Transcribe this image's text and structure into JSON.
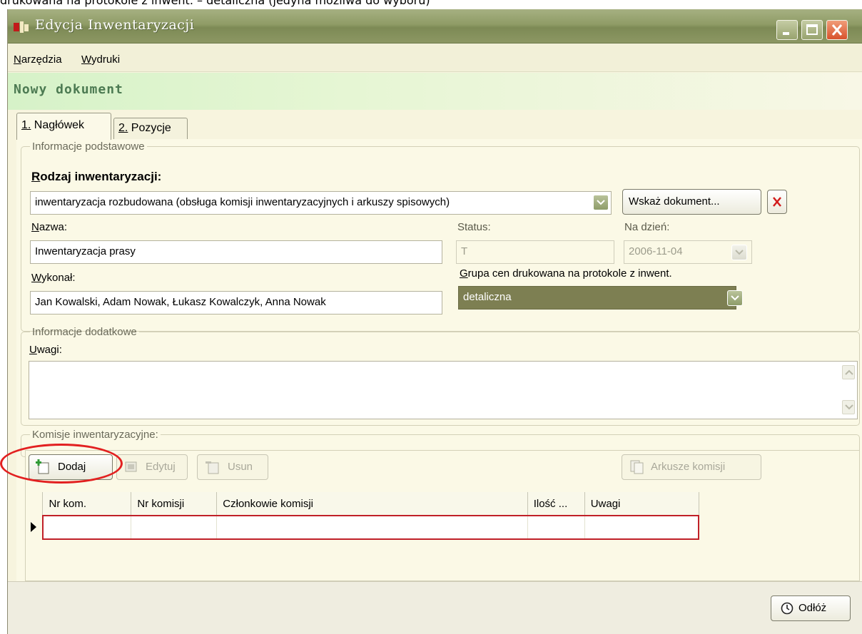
{
  "caption": "drukowana na protokole z inwent. – detaliczna (jedyna możliwa do wyboru)",
  "window": {
    "title": "Edycja Inwentaryzacji"
  },
  "menu": {
    "items": [
      "Narzędzia",
      "Wydruki"
    ]
  },
  "document_state": "Nowy dokument",
  "tabs": [
    {
      "label": "1. Nagłówek",
      "active": true
    },
    {
      "label": "2. Pozycje",
      "active": false
    }
  ],
  "basic_info": {
    "legend": "Informacje podstawowe",
    "type_label": "Rodzaj inwentaryzacji:",
    "type_value": "inwentaryzacja rozbudowana (obsługa komisji inwentaryzacyjnych i arkuszy spisowych)",
    "select_document_button": "Wskaż dokument...",
    "name_label": "Nazwa:",
    "name_value": "Inwentaryzacja prasy",
    "status_label": "Status:",
    "status_value": "T",
    "date_label": "Na dzień:",
    "date_value": "2006-11-04",
    "performer_label": "Wykonał:",
    "performer_value": "Jan Kowalski, Adam Nowak, Łukasz Kowalczyk, Anna Nowak",
    "price_group_label": "Grupa cen drukowana na protokole z inwent.",
    "price_group_value": "detaliczna"
  },
  "additional_info": {
    "legend": "Informacje dodatkowe",
    "notes_label": "Uwagi:",
    "notes_value": ""
  },
  "committees": {
    "legend": "Komisje inwentaryzacyjne:",
    "buttons": {
      "add": "Dodaj",
      "edit": "Edytuj",
      "delete": "Usun",
      "sheets": "Arkusze komisji"
    },
    "columns": [
      "Nr kom.",
      "Nr komisji",
      "Członkowie komisji",
      "Ilość ...",
      "Uwagi"
    ],
    "rows": [
      [
        "",
        "",
        "",
        "",
        ""
      ]
    ]
  },
  "footer": {
    "postpone_button": "Odłóż"
  },
  "colors": {
    "titlebar": "#8f9c66",
    "window_bg": "#f7f4de",
    "selected_combo": "#7d7f52",
    "annotation": "#e22020"
  }
}
